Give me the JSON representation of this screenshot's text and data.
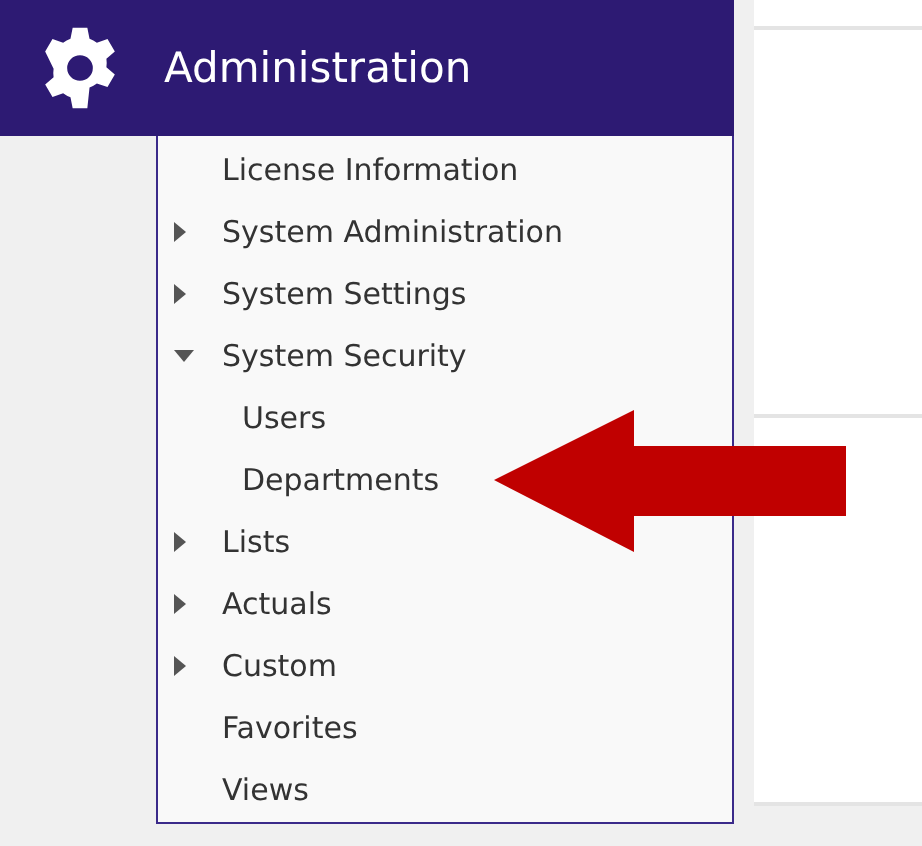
{
  "header": {
    "title": "Administration"
  },
  "menu": [
    {
      "label": "License Information"
    },
    {
      "label": "System Administration",
      "expanded": false
    },
    {
      "label": "System Settings",
      "expanded": false
    },
    {
      "label": "System Security",
      "expanded": true,
      "children": [
        {
          "label": "Users"
        },
        {
          "label": "Departments"
        }
      ]
    },
    {
      "label": "Lists",
      "expanded": false
    },
    {
      "label": "Actuals",
      "expanded": false
    },
    {
      "label": "Custom",
      "expanded": false
    },
    {
      "label": "Favorites"
    },
    {
      "label": "Views"
    }
  ]
}
